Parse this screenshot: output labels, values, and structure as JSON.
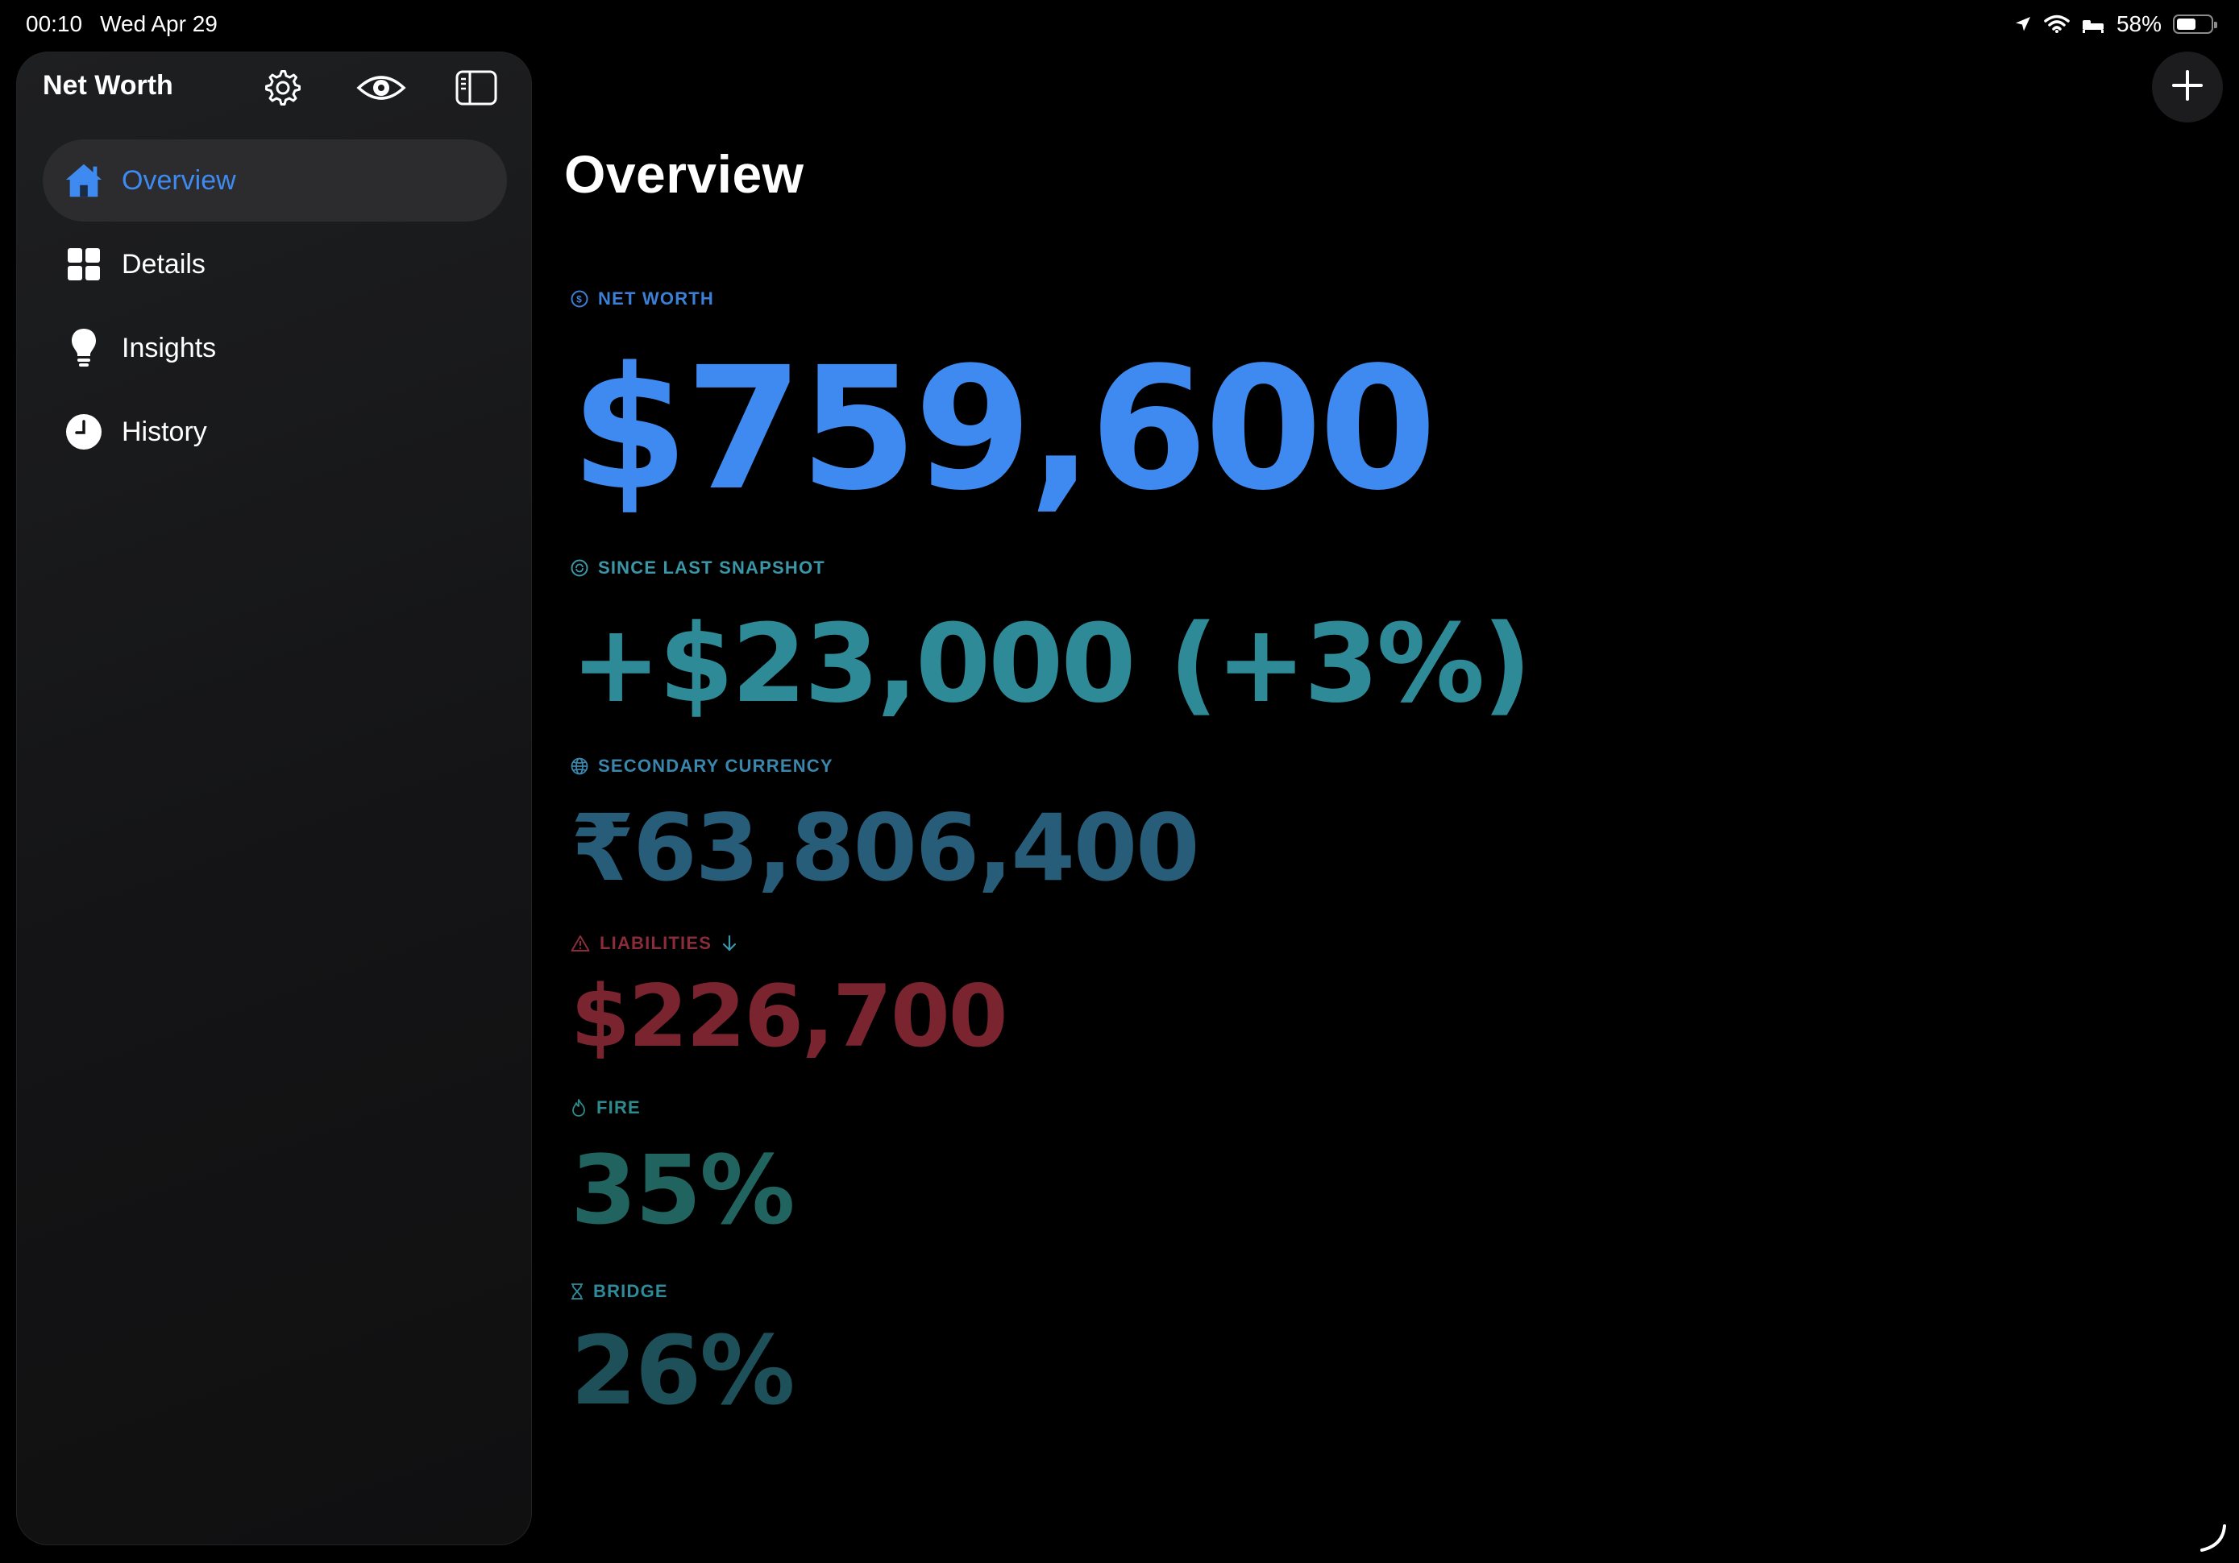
{
  "status_bar": {
    "time": "00:10",
    "date": "Wed Apr 29",
    "battery_percent": "58%",
    "battery_level": 0.58
  },
  "sidebar": {
    "title": "Net Worth",
    "header_icons": [
      "gear-icon",
      "eye-icon",
      "sidebar-toggle-icon"
    ],
    "items": [
      {
        "label": "Overview",
        "icon": "house-icon",
        "active": true
      },
      {
        "label": "Details",
        "icon": "grid-icon",
        "active": false
      },
      {
        "label": "Insights",
        "icon": "lightbulb-icon",
        "active": false
      },
      {
        "label": "History",
        "icon": "clock-icon",
        "active": false
      }
    ]
  },
  "main": {
    "title": "Overview",
    "add_icon": "plus-icon",
    "metrics": {
      "net_worth": {
        "label": "NET WORTH",
        "value": "$759,600",
        "icon": "dollar-circle-icon",
        "color": "#3f8af0"
      },
      "since_last_snapshot": {
        "label": "SINCE LAST SNAPSHOT",
        "value": "+$23,000 (+3%)",
        "icon": "refresh-circle-icon",
        "color": "#2f8a97"
      },
      "secondary_currency": {
        "label": "SECONDARY CURRENCY",
        "value": "₹63,806,400",
        "icon": "globe-icon",
        "color": "#285d79"
      },
      "liabilities": {
        "label": "LIABILITIES",
        "value": "$226,700",
        "icon": "warning-triangle-icon",
        "sort_icon": "arrow-down-icon",
        "color": "#7a2430"
      },
      "fire": {
        "label": "FIRE",
        "value": "35%",
        "icon": "flame-icon",
        "color": "#21635e"
      },
      "bridge": {
        "label": "BRIDGE",
        "value": "26%",
        "icon": "hourglass-icon",
        "color": "#1e5059"
      }
    }
  }
}
